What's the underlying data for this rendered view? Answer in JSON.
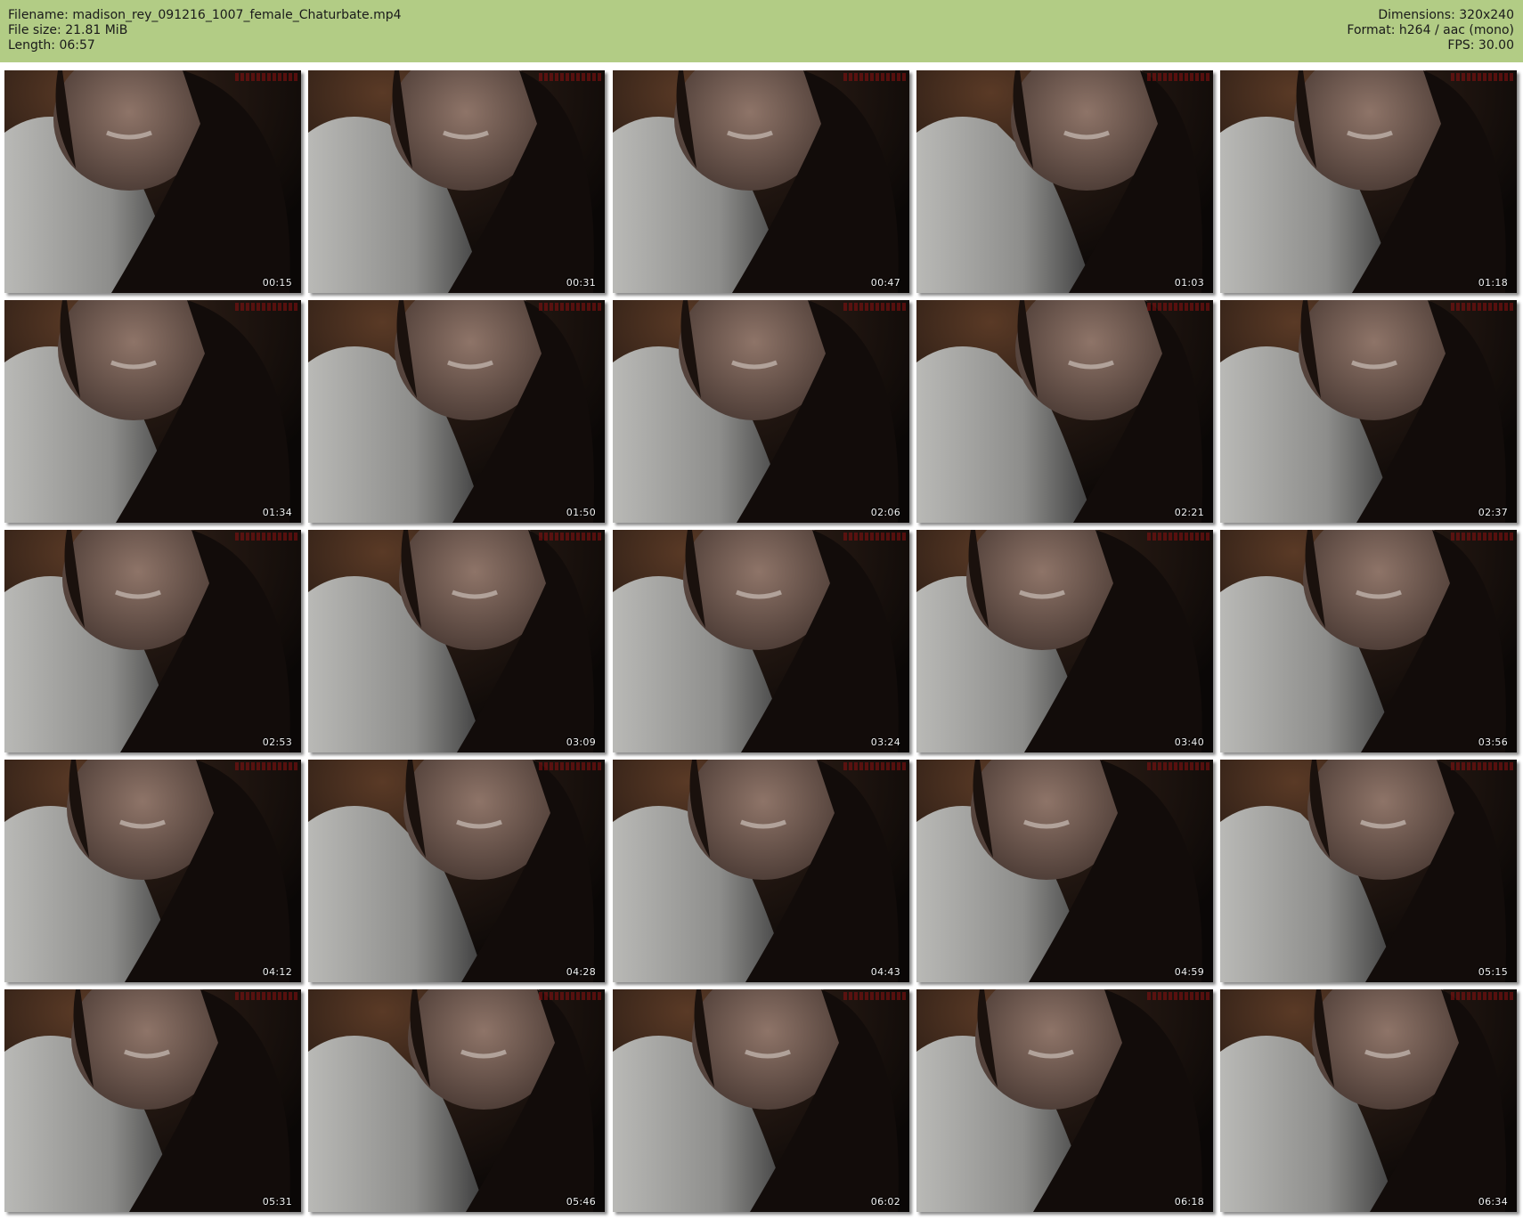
{
  "header": {
    "filename_label": "Filename:",
    "filename": "madison_rey_091216_1007_female_Chaturbate.mp4",
    "filesize_label": "File size:",
    "filesize": "21.81 MiB",
    "length_label": "Length:",
    "length": "06:57",
    "dimensions_label": "Dimensions:",
    "dimensions": "320x240",
    "format_label": "Format:",
    "format": "h264 / aac (mono)",
    "fps_label": "FPS:",
    "fps": "30.00"
  },
  "colors": {
    "header_bg": "#b2cc85",
    "page_bg": "#ffffff"
  },
  "thumbnails": [
    {
      "time": "00:15"
    },
    {
      "time": "00:31"
    },
    {
      "time": "00:47"
    },
    {
      "time": "01:03"
    },
    {
      "time": "01:18"
    },
    {
      "time": "01:34"
    },
    {
      "time": "01:50"
    },
    {
      "time": "02:06"
    },
    {
      "time": "02:21"
    },
    {
      "time": "02:37"
    },
    {
      "time": "02:53"
    },
    {
      "time": "03:09"
    },
    {
      "time": "03:24"
    },
    {
      "time": "03:40"
    },
    {
      "time": "03:56"
    },
    {
      "time": "04:12"
    },
    {
      "time": "04:28"
    },
    {
      "time": "04:43"
    },
    {
      "time": "04:59"
    },
    {
      "time": "05:15"
    },
    {
      "time": "05:31"
    },
    {
      "time": "05:46"
    },
    {
      "time": "06:02"
    },
    {
      "time": "06:18"
    },
    {
      "time": "06:34"
    }
  ]
}
